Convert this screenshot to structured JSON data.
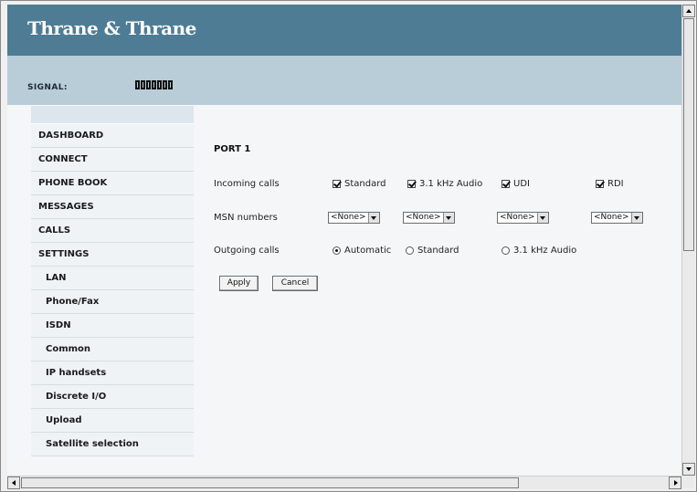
{
  "header": {
    "logo": "Thrane & Thrane",
    "color": "#4e7c94"
  },
  "signal": {
    "label": "SIGNAL:",
    "bars_total": 7
  },
  "sidebar": {
    "items": [
      {
        "label": "DASHBOARD",
        "sub": false
      },
      {
        "label": "CONNECT",
        "sub": false
      },
      {
        "label": "PHONE BOOK",
        "sub": false
      },
      {
        "label": "MESSAGES",
        "sub": false
      },
      {
        "label": "CALLS",
        "sub": false
      },
      {
        "label": "SETTINGS",
        "sub": false
      },
      {
        "label": "LAN",
        "sub": true
      },
      {
        "label": "Phone/Fax",
        "sub": true
      },
      {
        "label": "ISDN",
        "sub": true
      },
      {
        "label": "Common",
        "sub": true
      },
      {
        "label": "IP handsets",
        "sub": true
      },
      {
        "label": "Discrete I/O",
        "sub": true
      },
      {
        "label": "Upload",
        "sub": true
      },
      {
        "label": "Satellite selection",
        "sub": true
      }
    ]
  },
  "form": {
    "port_title": "PORT 1",
    "incoming": {
      "label": "Incoming calls",
      "options": [
        {
          "label": "Standard",
          "checked": true
        },
        {
          "label": "3.1 kHz Audio",
          "checked": true
        },
        {
          "label": "UDI",
          "checked": true
        },
        {
          "label": "RDI",
          "checked": true
        }
      ]
    },
    "msn": {
      "label": "MSN numbers",
      "selects": [
        "<None>",
        "<None>",
        "<None>",
        "<None>"
      ]
    },
    "outgoing": {
      "label": "Outgoing calls",
      "options": [
        {
          "label": "Automatic",
          "selected": true
        },
        {
          "label": "Standard",
          "selected": false
        },
        {
          "label": "3.1 kHz Audio",
          "selected": false
        }
      ]
    },
    "apply_label": "Apply",
    "cancel_label": "Cancel"
  }
}
